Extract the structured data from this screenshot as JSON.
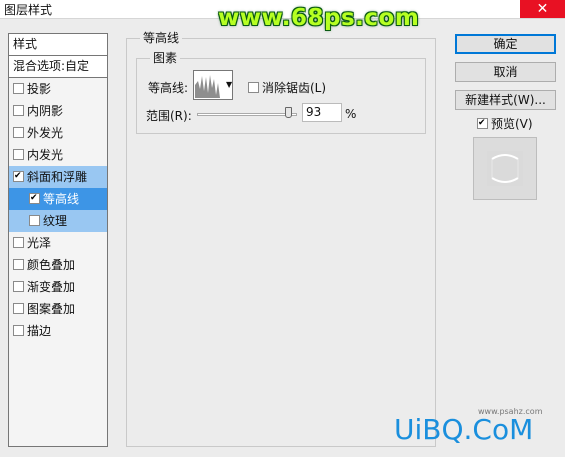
{
  "window": {
    "title": "图层样式",
    "close_glyph": "✕"
  },
  "watermark_top": "www.68ps.com",
  "styles_panel": {
    "header": "样式",
    "blend_options": "混合选项:自定",
    "items": [
      {
        "label": "投影",
        "checked": false
      },
      {
        "label": "内阴影",
        "checked": false
      },
      {
        "label": "外发光",
        "checked": false
      },
      {
        "label": "内发光",
        "checked": false
      },
      {
        "label": "斜面和浮雕",
        "checked": true
      },
      {
        "label": "等高线",
        "checked": true
      },
      {
        "label": "纹理",
        "checked": false
      },
      {
        "label": "光泽",
        "checked": false
      },
      {
        "label": "颜色叠加",
        "checked": false
      },
      {
        "label": "渐变叠加",
        "checked": false
      },
      {
        "label": "图案叠加",
        "checked": false
      },
      {
        "label": "描边",
        "checked": false
      }
    ]
  },
  "contour_panel": {
    "group_title": "等高线",
    "subgroup_title": "图素",
    "contour_label": "等高线:",
    "anti_alias_label": "消除锯齿(L)",
    "anti_alias_checked": false,
    "range_label": "范围(R):",
    "range_value": "93",
    "range_unit": "%"
  },
  "buttons": {
    "ok": "确定",
    "cancel": "取消",
    "new_style": "新建样式(W)..."
  },
  "preview": {
    "label": "预览(V)",
    "checked": true
  },
  "watermark_bottom": {
    "brand": "UiBQ.CoM",
    "url": "www.psahz.com"
  }
}
